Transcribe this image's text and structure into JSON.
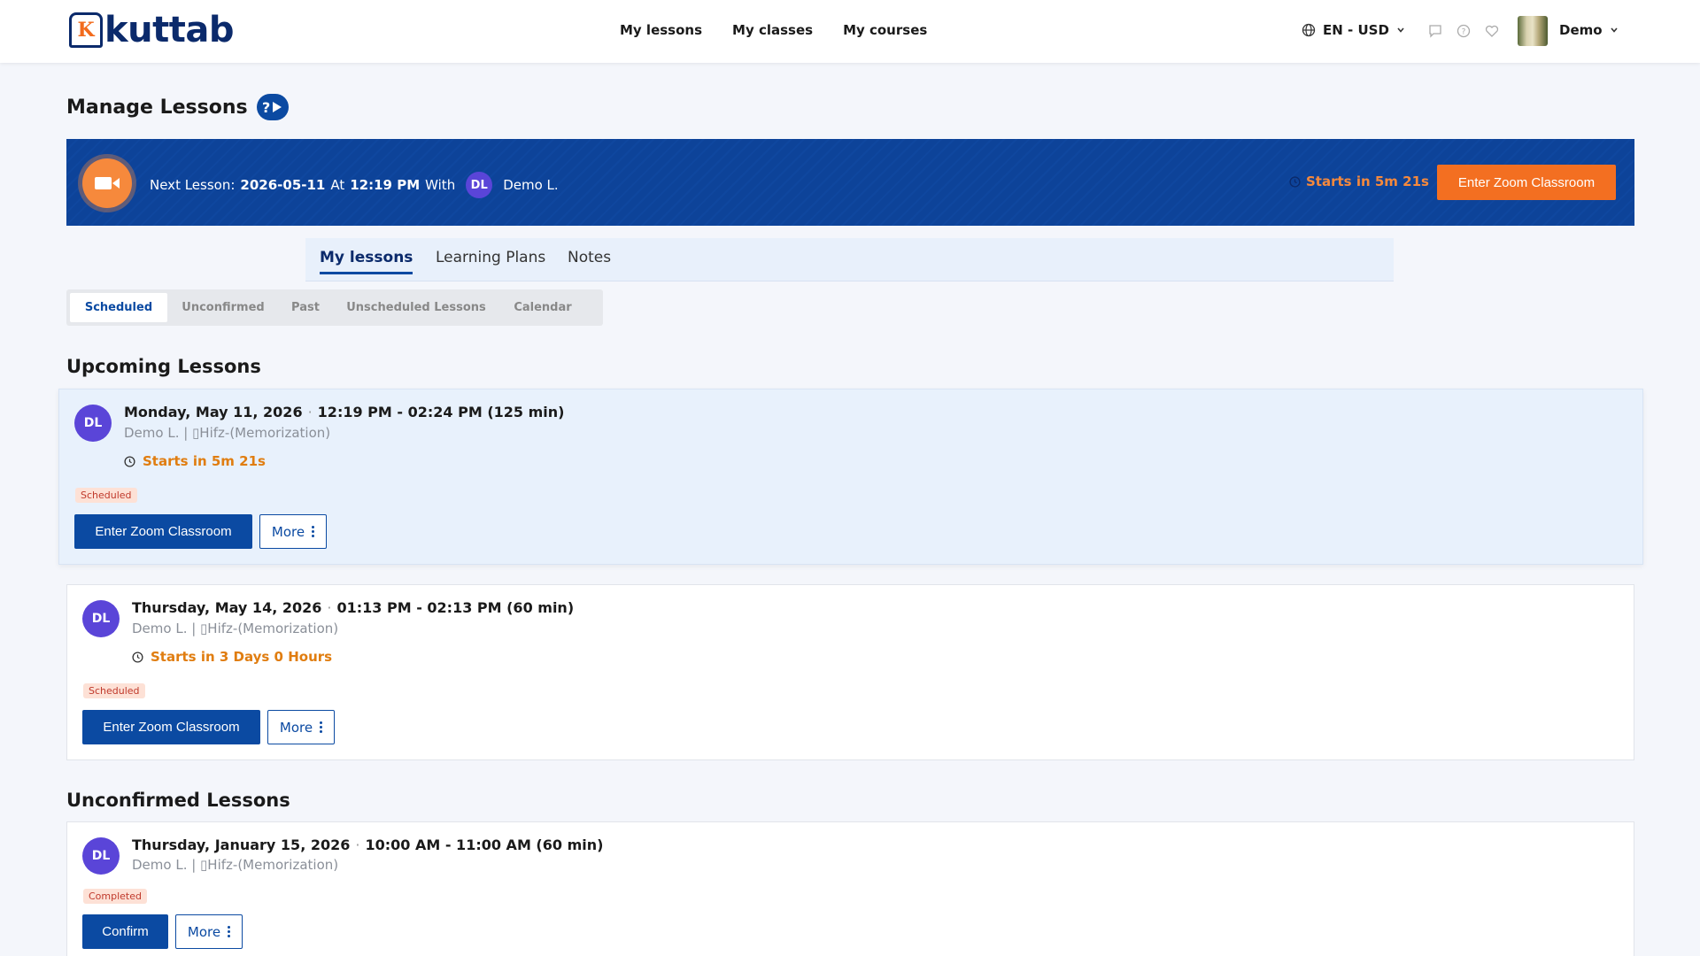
{
  "brand": {
    "logo_letter": "K",
    "logo_text": "kuttab"
  },
  "nav": {
    "items": [
      "My lessons",
      "My classes",
      "My courses"
    ]
  },
  "header": {
    "lang_currency": "EN - USD",
    "user_name": "Demo"
  },
  "page": {
    "title": "Manage Lessons",
    "help_label": "?"
  },
  "banner": {
    "prefix": "Next Lesson:",
    "date": "2026-05-11",
    "at": "At",
    "time": "12:19 PM",
    "with": "With",
    "initials": "DL",
    "teacher": "Demo L.",
    "timer": "Starts in 5m 21s",
    "button": "Enter Zoom Classroom"
  },
  "tabs": [
    "My lessons",
    "Learning Plans",
    "Notes"
  ],
  "subtabs": [
    "Scheduled",
    "Unconfirmed",
    "Past",
    "Unscheduled Lessons",
    "Calendar"
  ],
  "sections": {
    "upcoming": "Upcoming Lessons",
    "unconfirmed": "Unconfirmed Lessons"
  },
  "lessons": [
    {
      "initials": "DL",
      "date": "Monday, May 11, 2026",
      "dot": "·",
      "time": "12:19 PM - 02:24 PM (125 min)",
      "who": "Demo L. | ▯Hifz-(Memorization)",
      "starts": "Starts in 5m 21s",
      "status": "Scheduled",
      "primary": "Enter Zoom Classroom",
      "more": "More"
    },
    {
      "initials": "DL",
      "date": "Thursday, May 14, 2026",
      "dot": "·",
      "time": "01:13 PM - 02:13 PM (60 min)",
      "who": "Demo L. | ▯Hifz-(Memorization)",
      "starts": "Starts in 3 Days 0 Hours",
      "status": "Scheduled",
      "primary": "Enter Zoom Classroom",
      "more": "More"
    },
    {
      "initials": "DL",
      "date": "Thursday, January 15, 2026",
      "dot": "·",
      "time": "10:00 AM - 11:00 AM (60 min)",
      "who": "Demo L. | ▯Hifz-(Memorization)",
      "status": "Completed",
      "primary": "Confirm",
      "more": "More"
    }
  ],
  "colors": {
    "primary": "#0b4aa2",
    "accent": "#f36f21",
    "badge": "#5a45d8"
  }
}
